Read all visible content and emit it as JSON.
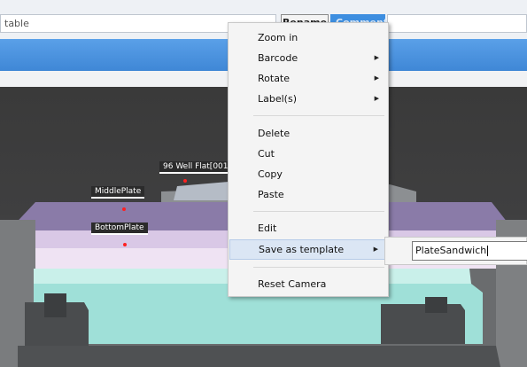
{
  "toolbar": {
    "name_value": "table",
    "rename_label": "Rename",
    "comment_label": "Comment"
  },
  "scene": {
    "labels": {
      "top_plate": "96 Well Flat[001",
      "middle_plate": "MiddlePlate",
      "bottom_plate": "BottomPlate"
    }
  },
  "context_menu": {
    "items": [
      {
        "label": "Zoom in",
        "has_submenu": false
      },
      {
        "label": "Barcode",
        "has_submenu": true
      },
      {
        "label": "Rotate",
        "has_submenu": true
      },
      {
        "label": "Label(s)",
        "has_submenu": true
      },
      {
        "label": "Delete",
        "has_submenu": false
      },
      {
        "label": "Cut",
        "has_submenu": false
      },
      {
        "label": "Copy",
        "has_submenu": false
      },
      {
        "label": "Paste",
        "has_submenu": false
      },
      {
        "label": "Edit",
        "has_submenu": false
      },
      {
        "label": "Save as template",
        "has_submenu": true,
        "highlighted": true
      },
      {
        "label": "Reset Camera",
        "has_submenu": false
      }
    ],
    "submenu_arrow": "▶"
  },
  "template_submenu": {
    "input_value": "PlateSandwich"
  }
}
